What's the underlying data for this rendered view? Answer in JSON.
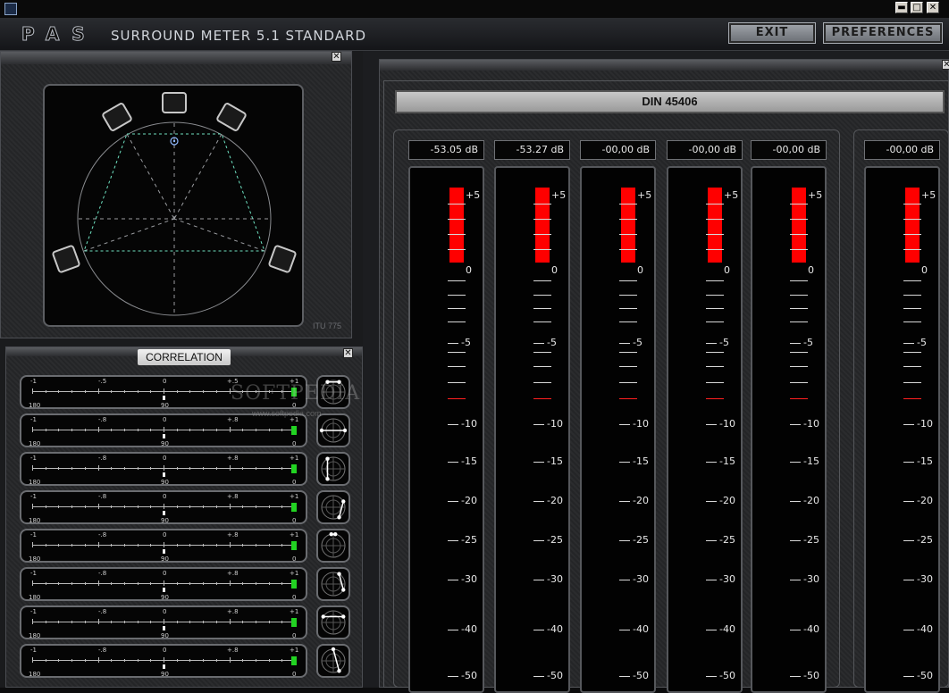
{
  "window": {
    "minimize": "▬",
    "maximize": "□",
    "close": "✕"
  },
  "header": {
    "logo": "PAS",
    "title": "SURROUND METER  5.1 STANDARD",
    "exit_label": "EXIT",
    "preferences_label": "PREFERENCES"
  },
  "panels": {
    "close_glyph": "✕"
  },
  "surround": {
    "itu_label": "ITU 775"
  },
  "correlation": {
    "title": "CORRELATION",
    "rows": [
      {
        "left": "-1",
        "mid_left": "-.5",
        "center": "0",
        "mid_right": "+.5",
        "right": "+1",
        "bottom_left": "180",
        "bottom_center": "90",
        "bottom_right": "0"
      },
      {
        "left": "-1",
        "mid_left": "-.8",
        "center": "0",
        "mid_right": "+.8",
        "right": "+1",
        "bottom_left": "180",
        "bottom_center": "90",
        "bottom_right": "0"
      },
      {
        "left": "-1",
        "mid_left": "-.8",
        "center": "0",
        "mid_right": "+.8",
        "right": "+1",
        "bottom_left": "180",
        "bottom_center": "90",
        "bottom_right": "0"
      },
      {
        "left": "-1",
        "mid_left": "-.8",
        "center": "0",
        "mid_right": "+.8",
        "right": "+1",
        "bottom_left": "180",
        "bottom_center": "90",
        "bottom_right": "0"
      },
      {
        "left": "-1",
        "mid_left": "-.8",
        "center": "0",
        "mid_right": "+.8",
        "right": "+1",
        "bottom_left": "180",
        "bottom_center": "90",
        "bottom_right": "0"
      },
      {
        "left": "-1",
        "mid_left": "-.8",
        "center": "0",
        "mid_right": "+.8",
        "right": "+1",
        "bottom_left": "180",
        "bottom_center": "90",
        "bottom_right": "0"
      },
      {
        "left": "-1",
        "mid_left": "-.8",
        "center": "0",
        "mid_right": "+.8",
        "right": "+1",
        "bottom_left": "180",
        "bottom_center": "90",
        "bottom_right": "0"
      },
      {
        "left": "-1",
        "mid_left": "-.8",
        "center": "0",
        "mid_right": "+.8",
        "right": "+1",
        "bottom_left": "180",
        "bottom_center": "90",
        "bottom_right": "0"
      }
    ]
  },
  "meters": {
    "standard": "DIN 45406",
    "readouts": [
      "-53.05 dB",
      "-53.27 dB",
      "-00,00 dB",
      "-00,00 dB",
      "-00,00 dB",
      "-00,00 dB"
    ],
    "scale_labels": [
      "+5",
      "0",
      "-5",
      "-10",
      "-15",
      "-20",
      "-25",
      "-30",
      "-40",
      "-50"
    ],
    "over_color": "#ff0000"
  },
  "watermark": {
    "text": "SOFTPEDIA",
    "url": "www.softpedia.com"
  }
}
